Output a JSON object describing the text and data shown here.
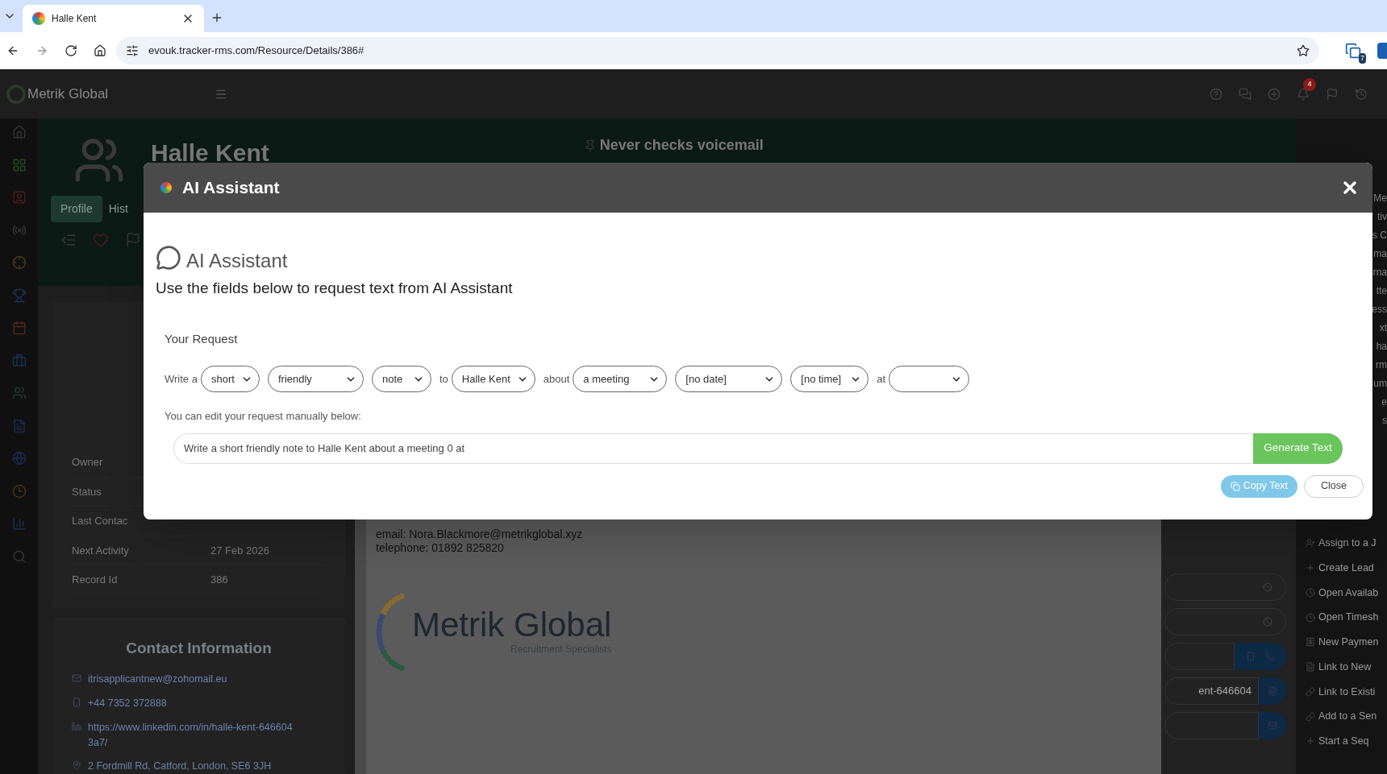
{
  "browser": {
    "tab_title": "Halle Kent",
    "url": "evouk.tracker-rms.com/Resource/Details/386#",
    "extension_badge": "7"
  },
  "app_header": {
    "logo_text": "Metrik Global",
    "notification_badge": "4"
  },
  "profile": {
    "name": "Halle Kent",
    "tagline": "Never checks voicemail",
    "tabs": [
      {
        "label": "Profile",
        "selected": true
      },
      {
        "label": "Hist",
        "selected": false
      }
    ]
  },
  "details": [
    {
      "label": "Owner"
    },
    {
      "label": "Status"
    },
    {
      "label": "Last Contac"
    },
    {
      "label": "Next Activity",
      "value": "27 Feb 2026"
    },
    {
      "label": "Record Id",
      "value": "386"
    }
  ],
  "contact": {
    "heading": "Contact Information",
    "items": [
      {
        "kind": "email",
        "text": "itrisapplicantnew@zohomail.eu"
      },
      {
        "kind": "phone",
        "text": "+44 7352 372888"
      },
      {
        "kind": "linkedin",
        "text": "https://www.linkedin.com/in/halle-kent-6466043a7/"
      },
      {
        "kind": "address",
        "text": "2 Fordmill Rd, Catford, London, SE6 3JH"
      }
    ]
  },
  "document": {
    "lines": [
      "email: Nora.Blackmore@metrikglobal.xyz",
      "telephone: 01892 825820"
    ],
    "logo_name": "Metrik Global",
    "logo_tagline": "Recruitment Specialists"
  },
  "side_fields": [
    {
      "kind": "blocked"
    },
    {
      "kind": "blocked"
    },
    {
      "kind": "phone"
    },
    {
      "kind": "text",
      "value": "ent-646604"
    },
    {
      "kind": "email"
    }
  ],
  "right_edge_fragments": [
    "Me",
    "tiv",
    "s C",
    "ma",
    "rna",
    "tte",
    "ess",
    "xt",
    "ha",
    "rm",
    "um",
    "e",
    "s"
  ],
  "actions": [
    {
      "label": "Assign to a J"
    },
    {
      "label": "Create Lead"
    },
    {
      "label": "Open Availab"
    },
    {
      "label": "Open Timesh"
    },
    {
      "label": "New Paymen"
    },
    {
      "label": "Link to New"
    },
    {
      "label": "Link to Existi"
    },
    {
      "label": "Add to a Sen"
    },
    {
      "label": "Start a Seq"
    }
  ],
  "modal": {
    "title": "AI Assistant",
    "heading": "AI Assistant",
    "subtitle": "Use the fields below to request text from AI Assistant",
    "section_label": "Your Request",
    "request_parts": [
      {
        "kind": "text",
        "text": "Write a"
      },
      {
        "kind": "select",
        "value": "short"
      },
      {
        "kind": "select",
        "value": "friendly"
      },
      {
        "kind": "select",
        "value": "note"
      },
      {
        "kind": "text",
        "text": "to"
      },
      {
        "kind": "select",
        "value": "Halle Kent"
      },
      {
        "kind": "text",
        "text": "about"
      },
      {
        "kind": "select",
        "value": "a meeting"
      },
      {
        "kind": "select",
        "value": "[no date]"
      },
      {
        "kind": "select",
        "value": "[no time]"
      },
      {
        "kind": "text",
        "text": "at"
      },
      {
        "kind": "select"
      }
    ],
    "manual_label": "You can edit your request manually below:",
    "request_text": "Write a short friendly note to Halle Kent about a meeting 0 at",
    "generate_button": "Generate Text",
    "copy_button": "Copy Text",
    "close_button": "Close"
  }
}
